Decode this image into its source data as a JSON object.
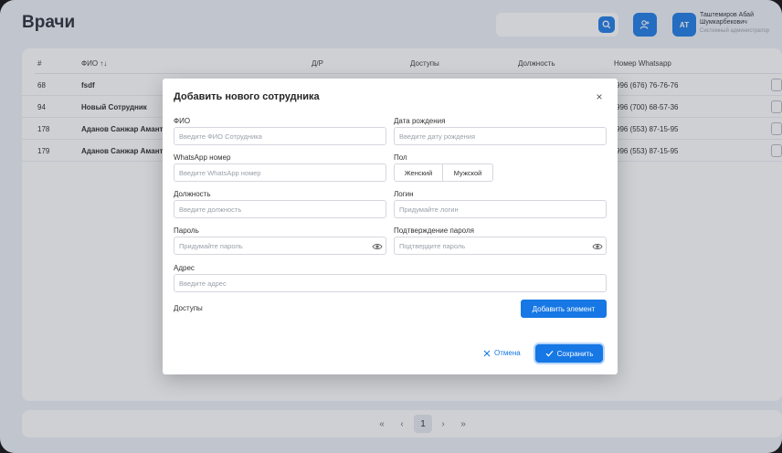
{
  "header": {
    "title": "Врачи",
    "user_initials": "АТ",
    "user_name": "Таштемиров Абай Шумкарбекович",
    "user_role": "Системный администратор"
  },
  "table": {
    "columns": {
      "num": "#",
      "name": "ФИО ↑↓",
      "dob": "Д/Р",
      "access": "Доступы",
      "position": "Должность",
      "phone": "Номер Whatsapp"
    },
    "rows": [
      {
        "num": "68",
        "name": "fsdf",
        "phone": "996 (676) 76-76-76"
      },
      {
        "num": "94",
        "name": "Новый Сотрудник",
        "phone": "996 (700) 68-57-36"
      },
      {
        "num": "178",
        "name": "Аданов Санжар Амант",
        "phone": "996 (553) 87-15-95"
      },
      {
        "num": "179",
        "name": "Аданов Санжар Амант",
        "phone": "996 (553) 87-15-95"
      }
    ]
  },
  "pagination": {
    "first": "«",
    "prev": "‹",
    "current": "1",
    "next": "›",
    "last": "»"
  },
  "modal": {
    "title": "Добавить нового сотрудника",
    "close": "×",
    "fio_label": "ФИО",
    "fio_placeholder": "Введите ФИО Сотрудника",
    "dob_label": "Дата рождения",
    "dob_placeholder": "Введите дату рождения",
    "whatsapp_label": "WhatsApp номер",
    "whatsapp_placeholder": "Введите WhatsApp номер",
    "gender_label": "Пол",
    "gender_female": "Женский",
    "gender_male": "Мужской",
    "position_label": "Должность",
    "position_placeholder": "Введите должность",
    "login_label": "Логин",
    "login_placeholder": "Придумайте логин",
    "password_label": "Пароль",
    "password_placeholder": "Придумайте пароль",
    "confirm_label": "Подтверждение пароля",
    "confirm_placeholder": "Подтвердите пароль",
    "address_label": "Адрес",
    "address_placeholder": "Введите адрес",
    "access_label": "Доступы",
    "add_element": "Добавить элемент",
    "cancel": "Отмена",
    "save": "Сохранить"
  },
  "colors": {
    "accent": "#1677e5",
    "background": "#eef0f6"
  }
}
